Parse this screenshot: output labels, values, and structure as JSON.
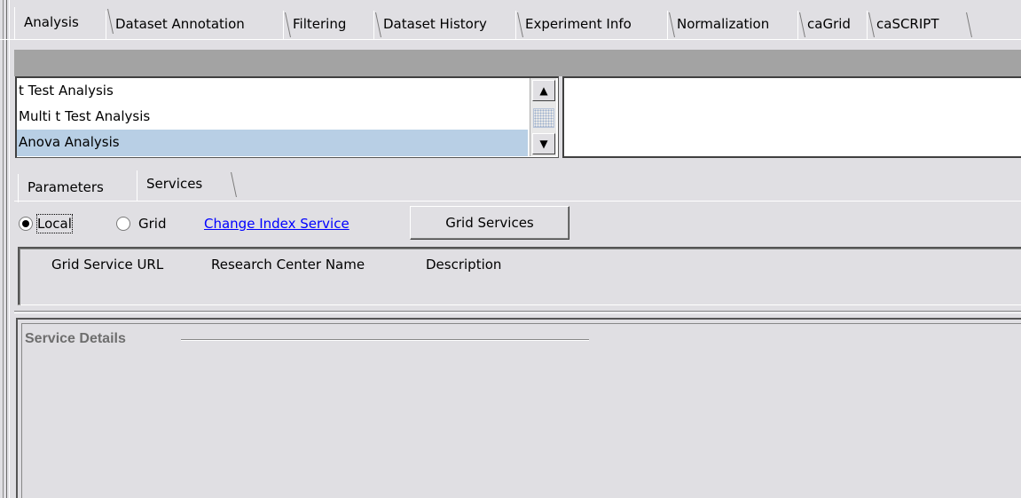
{
  "top_tabs": [
    {
      "label": "Analysis",
      "selected": true
    },
    {
      "label": "Dataset Annotation",
      "selected": false
    },
    {
      "label": "Filtering",
      "selected": false
    },
    {
      "label": "Dataset History",
      "selected": false
    },
    {
      "label": "Experiment Info",
      "selected": false
    },
    {
      "label": "Normalization",
      "selected": false
    },
    {
      "label": "caGrid",
      "selected": false
    },
    {
      "label": "caSCRIPT",
      "selected": false
    }
  ],
  "analysis_list": {
    "items": [
      "t Test Analysis",
      "Multi t Test Analysis",
      "Anova Analysis"
    ],
    "selected": "Anova Analysis"
  },
  "inner_tabs": [
    {
      "label": "Parameters",
      "selected": false
    },
    {
      "label": "Services",
      "selected": true
    }
  ],
  "services": {
    "radio_local": "Local",
    "radio_grid": "Grid",
    "selected_radio": "Local",
    "change_index_link": "Change Index Service",
    "grid_services_button": "Grid Services",
    "columns": [
      "Grid Service URL",
      "Research Center Name",
      "Description"
    ]
  },
  "service_details": {
    "title": "Service Details"
  },
  "colors": {
    "background": "#e0dfe3",
    "band": "#a3a3a3",
    "selection": "#b8cfe5",
    "link": "#0000ff"
  }
}
